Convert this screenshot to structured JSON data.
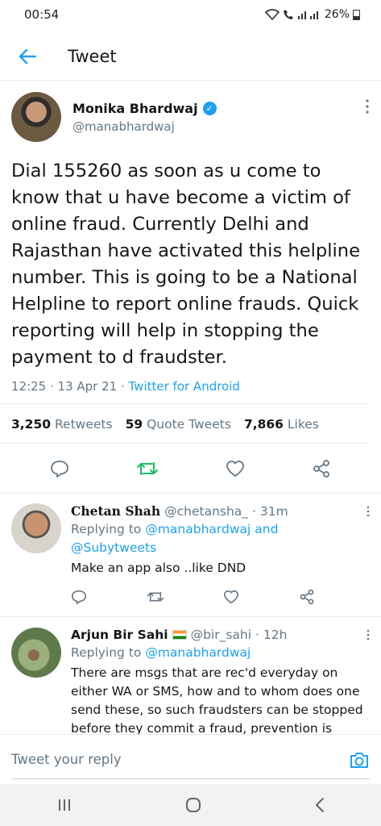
{
  "status": {
    "time": "00:54",
    "battery": "26%"
  },
  "header": {
    "title": "Tweet"
  },
  "tweet": {
    "author_name": "Monika Bhardwaj",
    "author_handle": "@manabhardwaj",
    "body": "Dial 155260 as soon as u come to know that u have become a victim of online fraud. Currently Delhi and Rajasthan have activated this helpline number. This is going to be a National Helpline to report online frauds. Quick reporting will help in stopping the payment to d fraudster.",
    "time": "12:25 · 13 Apr 21 · ",
    "source": "Twitter for Android",
    "retweets_count": "3,250",
    "retweets_label": "Retweets",
    "quotes_count": "59",
    "quotes_label": "Quote Tweets",
    "likes_count": "7,866",
    "likes_label": "Likes",
    "accent_color": "#1da1f2",
    "retweet_color": "#17bf63"
  },
  "replies": [
    {
      "name": "Chetan Shah",
      "handle": "@chetansha_",
      "age": "· 31m",
      "replying_prefix": "Replying to ",
      "mention_1": "@manabhardwaj",
      "mention_joiner": " and",
      "mention_2": "@Subytweets",
      "text": "Make an app also ..like DND"
    },
    {
      "name": "Arjun Bir Sahi",
      "handle": "@bir_sahi",
      "age": "· 12h",
      "replying_prefix": "Replying to ",
      "mention_1": "@manabhardwaj",
      "text": "There are msgs that are rec'd everyday on either WA or SMS, how and to whom does one send these, so such fraudsters can be stopped before they commit a fraud, prevention is"
    }
  ],
  "composer": {
    "placeholder": "Tweet your reply"
  }
}
